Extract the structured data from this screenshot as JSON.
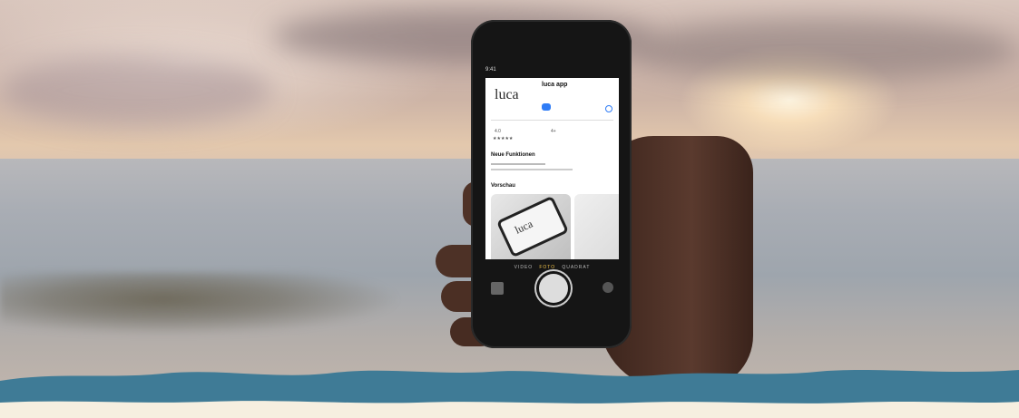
{
  "phone_screen": {
    "status_time": "9:41",
    "brand_logo_text": "luca",
    "app_name": "luca app",
    "app_subtitle": "",
    "rating_value": "4.0",
    "age_value": "4+",
    "section_whats_new": "Neue Funktionen",
    "section_preview": "Vorschau",
    "preview_logo_text": "luca"
  },
  "camera_modes": {
    "left": "VIDEO",
    "active": "FOTO",
    "right": "QUADRAT"
  },
  "colors": {
    "wave_blue": "#3f7b96",
    "wave_cream": "#f6efe0",
    "phone_body": "#151515",
    "camera_active": "#f0c24a"
  }
}
